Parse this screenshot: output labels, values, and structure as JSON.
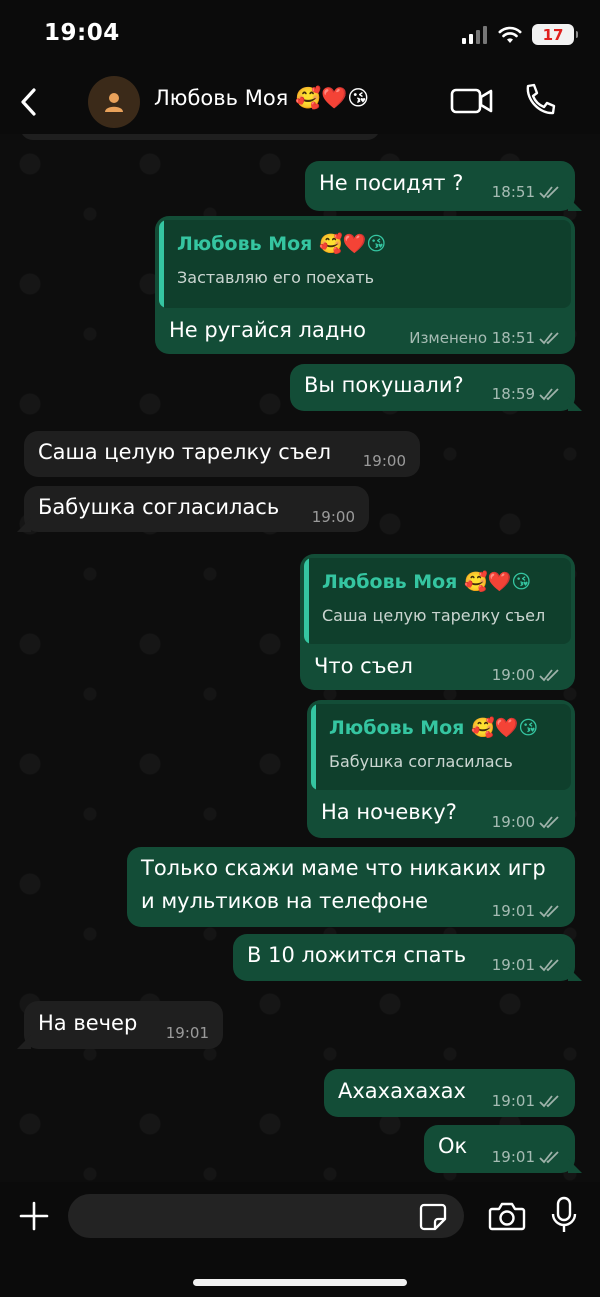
{
  "status": {
    "time": "19:04",
    "battery": "17"
  },
  "header": {
    "name": "Любовь Моя 🥰❤️😘"
  },
  "messages": [
    {
      "text": "Не посидят ?",
      "time": "18:51"
    },
    {
      "quote_name": "Любовь Моя 🥰❤️😘",
      "quote_text": "Заставляю его поехать",
      "text": "Не ругайся ладно",
      "time": "Изменено 18:51"
    },
    {
      "text": "Вы покушали?",
      "time": "18:59"
    },
    {
      "text": "Саша целую тарелку съел",
      "time": "19:00"
    },
    {
      "text": "Бабушка согласилась",
      "time": "19:00"
    },
    {
      "quote_name": "Любовь Моя 🥰❤️😘",
      "quote_text": "Саша целую тарелку съел",
      "text": "Что съел",
      "time": "19:00"
    },
    {
      "quote_name": "Любовь Моя 🥰❤️😘",
      "quote_text": "Бабушка согласилась",
      "text": "На ночевку?",
      "time": "19:00"
    },
    {
      "text_line1": "Только скажи маме что никаких игр",
      "text_line2": "и мультиков на телефоне",
      "time": "19:01"
    },
    {
      "text": "В 10 ложится спать",
      "time": "19:01"
    },
    {
      "text": "На вечер",
      "time": "19:01"
    },
    {
      "text": "Ахахахахах",
      "time": "19:01"
    },
    {
      "text": "Ок",
      "time": "19:01"
    }
  ],
  "composer": {
    "placeholder": ""
  },
  "colors": {
    "outgoing": "#134d37",
    "incoming": "#1f1f1f",
    "accent": "#35c5a1",
    "background": "#0b0b0b"
  },
  "icons": [
    "back-icon",
    "avatar-icon",
    "video-call-icon",
    "phone-icon",
    "plus-icon",
    "sticker-icon",
    "camera-icon",
    "mic-icon",
    "double-check-icon"
  ]
}
